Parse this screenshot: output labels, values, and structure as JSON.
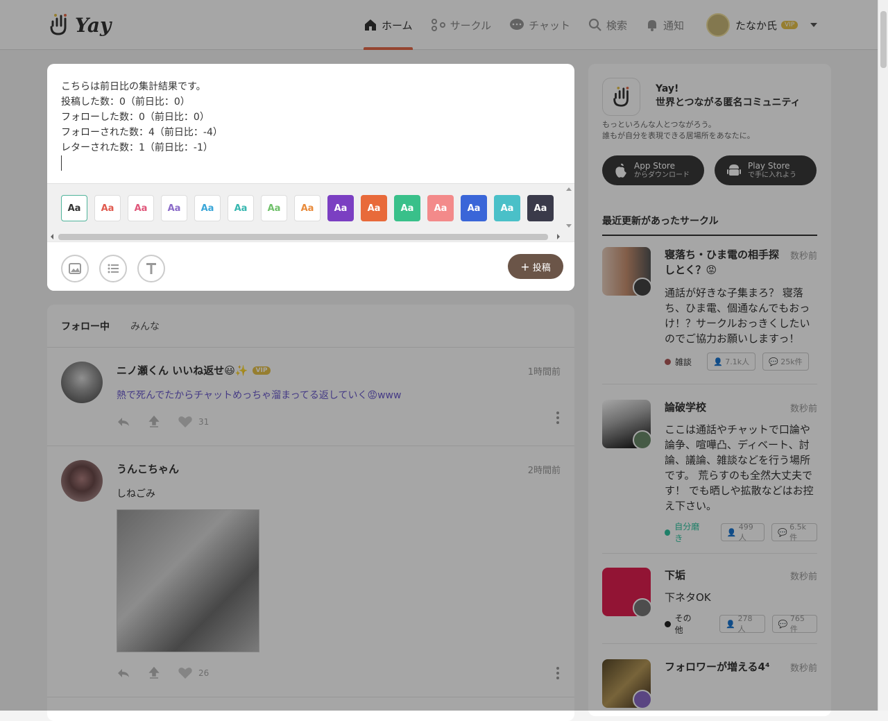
{
  "header": {
    "logo_text": "Yay",
    "nav": [
      {
        "label": "ホーム",
        "icon": "home-icon"
      },
      {
        "label": "サークル",
        "icon": "circle-icon"
      },
      {
        "label": "チャット",
        "icon": "chat-icon"
      },
      {
        "label": "検索",
        "icon": "search-icon"
      },
      {
        "label": "通知",
        "icon": "bell-icon"
      }
    ],
    "user_name": "たなか氏",
    "vip": "VIP"
  },
  "composer": {
    "lines": [
      "こちらは前日比の集計結果です。",
      "投稿した数：0（前日比：0）",
      "フォローした数：0（前日比：0）",
      "フォローされた数：4（前日比：-4）",
      "レターされた数：1（前日比：-1）"
    ],
    "swatch_label": "Aa",
    "swatches": [
      {
        "bg": "#ffffff",
        "fg": "#333333"
      },
      {
        "bg": "#ffffff",
        "fg": "#e05a4f"
      },
      {
        "bg": "#ffffff",
        "fg": "#e0567a"
      },
      {
        "bg": "#ffffff",
        "fg": "#8a6ac8"
      },
      {
        "bg": "#ffffff",
        "fg": "#3aa6d8"
      },
      {
        "bg": "#ffffff",
        "fg": "#37b7b0"
      },
      {
        "bg": "#ffffff",
        "fg": "#6fc06a"
      },
      {
        "bg": "#ffffff",
        "fg": "#e88a3a"
      },
      {
        "bg": "#7b3fc2",
        "fg": "#ffffff"
      },
      {
        "bg": "#e86a3a",
        "fg": "#ffffff"
      },
      {
        "bg": "#39c08a",
        "fg": "#ffffff"
      },
      {
        "bg": "#f38a8a",
        "fg": "#ffffff"
      },
      {
        "bg": "#3a66d8",
        "fg": "#ffffff"
      },
      {
        "bg": "#4ac0c8",
        "fg": "#ffffff"
      },
      {
        "bg": "#3a3a4a",
        "fg": "#ffffff"
      }
    ],
    "post_label": "投稿"
  },
  "feed": {
    "tabs": [
      "フォロー中",
      "みんな"
    ],
    "posts": [
      {
        "name": "ニノ瀬くん いいね返せ😃✨",
        "vip": "VIP",
        "time": "1時間前",
        "body": "熱で死んでたからチャットめっちゃ溜まってる返していく😡www",
        "likes": "31"
      },
      {
        "name": "うんこちゃん",
        "time": "2時間前",
        "body": "しねごみ",
        "likes": "26"
      }
    ]
  },
  "sidebar": {
    "app_name": "Yay!",
    "app_tagline": "世界とつながる匿名コミュニティ",
    "desc1": "もっといろんな人とつながろう。",
    "desc2": "誰もが自分を表現できる居場所をあなたに。",
    "app_store": {
      "title": "App Store",
      "sub": "からダウンロード"
    },
    "play_store": {
      "title": "Play Store",
      "sub": "で手に入れよう"
    },
    "heading": "最近更新があったサークル",
    "circles": [
      {
        "name": "寝落ち・ひま電の相手探しとく？😡",
        "time": "数秒前",
        "desc": "通話が好きな子集まろ？ 寝落ち、ひま電、個通なんでもおっけ！？サークルおっきくしたいのでご協力お願いしますっ！",
        "category": "雑談",
        "cat_color": "#b05a5a",
        "members": "7.1k人",
        "posts": "25k件"
      },
      {
        "name": "論破学校",
        "time": "数秒前",
        "desc": "ここは通話やチャットで口論や論争、喧嘩凸、ディベート、討論、議論、雑談などを行う場所です。 荒らすのも全然大丈夫です！ でも晒しや拡散などはお控え下さい。",
        "category": "自分磨き",
        "cat_color": "#2ec4a0",
        "members": "499人",
        "posts": "6.5k件"
      },
      {
        "name": "下垢",
        "time": "数秒前",
        "desc": "下ネタOK",
        "category": "その他",
        "cat_color": "#222222",
        "members": "278人",
        "posts": "765件"
      },
      {
        "name": "フォロワーが増える4⁴",
        "time": "数秒前"
      }
    ]
  },
  "colors": {
    "accent": "#e56a4a",
    "post_button": "#6b5548",
    "link": "#6a5acd"
  }
}
